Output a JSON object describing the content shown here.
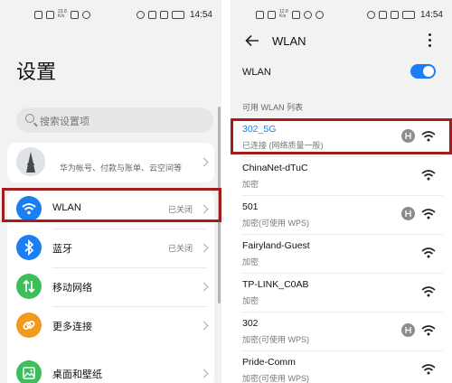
{
  "left_screen": {
    "status_bar": {
      "left_tiny_top": "23.8",
      "left_tiny_bottom": "K/s",
      "time": "14:54"
    },
    "title": "设置",
    "search": {
      "placeholder": "搜索设置项"
    },
    "account": {
      "text": "华为帐号、付款与账单、云空间等"
    },
    "menu": [
      {
        "label": "WLAN",
        "value": "已关闭",
        "icon": "wifi-icon",
        "color": "#1a7ef5"
      },
      {
        "label": "蓝牙",
        "value": "已关闭",
        "icon": "bluetooth-icon",
        "color": "#1a7ef5"
      },
      {
        "label": "移动网络",
        "value": "",
        "icon": "mobile-network-icon",
        "color": "#3cbf5a"
      },
      {
        "label": "更多连接",
        "value": "",
        "icon": "link-icon",
        "color": "#f29a1e"
      },
      {
        "label": "桌面和壁纸",
        "value": "",
        "icon": "wallpaper-icon",
        "color": "#3cbf5a"
      }
    ]
  },
  "right_screen": {
    "status_bar": {
      "left_tiny_top": "12.8",
      "left_tiny_bottom": "K/s",
      "time": "14:54"
    },
    "title": "WLAN",
    "toggle_label": "WLAN",
    "toggle_on": true,
    "section_header": "可用 WLAN 列表",
    "networks": [
      {
        "name": "302_5G",
        "status": "已连接 (网络质量一般)",
        "wps_badge": true,
        "highlighted": true
      },
      {
        "name": "ChinaNet-dTuC",
        "status": "加密",
        "wps_badge": false,
        "highlighted": false
      },
      {
        "name": "501",
        "status": "加密(可使用 WPS)",
        "wps_badge": true,
        "highlighted": false
      },
      {
        "name": "Fairyland-Guest",
        "status": "加密",
        "wps_badge": false,
        "highlighted": false
      },
      {
        "name": "TP-LINK_C0AB",
        "status": "加密",
        "wps_badge": false,
        "highlighted": false
      },
      {
        "name": "302",
        "status": "加密(可使用 WPS)",
        "wps_badge": true,
        "highlighted": false
      },
      {
        "name": "Pride-Comm",
        "status": "加密(可使用 WPS)",
        "wps_badge": false,
        "highlighted": false
      }
    ]
  },
  "colors": {
    "accent": "#1a7ef5",
    "highlight_box": "#a41d1d",
    "connected_name": "#1a7ef5"
  }
}
